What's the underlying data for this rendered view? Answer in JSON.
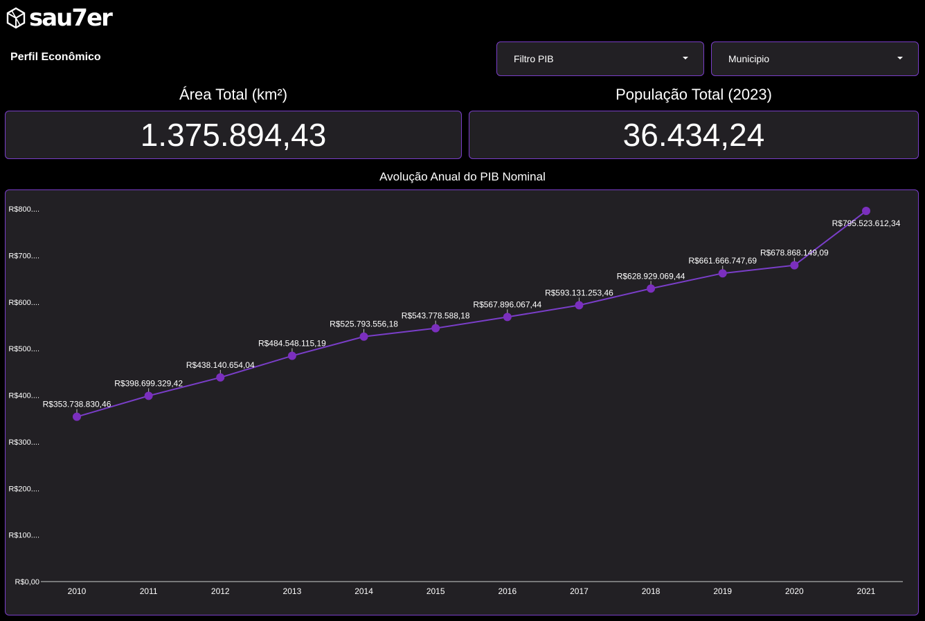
{
  "brand": {
    "name": "sau7er",
    "logo_icon": "geometric-hexagon-icon"
  },
  "page": {
    "title": "Perfil Econômico"
  },
  "filters": [
    {
      "label": "Filtro PIB"
    },
    {
      "label": "Municipio"
    }
  ],
  "kpis": {
    "area": {
      "title": "Área Total (km²)",
      "value": "1.375.894,43"
    },
    "population": {
      "title": "População Total (2023)",
      "value": "36.434,24"
    }
  },
  "colors": {
    "accent": "#7a3ec9",
    "point": "#7b2fbe",
    "panel": "#222024",
    "background": "#000000"
  },
  "chart_data": {
    "type": "line",
    "title": "Avolução Anual do PIB Nominal",
    "xlabel": "",
    "ylabel": "",
    "categories": [
      "2010",
      "2011",
      "2012",
      "2013",
      "2014",
      "2015",
      "2016",
      "2017",
      "2018",
      "2019",
      "2020",
      "2021"
    ],
    "series": [
      {
        "values": [
          353738830.46,
          398699329.42,
          438140654.04,
          484548115.19,
          525793556.18,
          543778588.18,
          567896067.44,
          593131253.46,
          628929069.44,
          661666747.69,
          678868149.09,
          795523612.34
        ],
        "labels": [
          "R$353.738.830,46",
          "R$398.699.329,42",
          "R$438.140.654,04",
          "R$484.548.115,19",
          "R$525.793.556,18",
          "R$543.778.588,18",
          "R$567.896.067,44",
          "R$593.131.253,46",
          "R$628.929.069,44",
          "R$661.666.747,69",
          "R$678.868.149,09",
          "R$795.523.612,34"
        ]
      }
    ],
    "y_ticks": [
      0,
      100000000,
      200000000,
      300000000,
      400000000,
      500000000,
      600000000,
      700000000,
      800000000
    ],
    "y_tick_labels": [
      "R$0,00",
      "R$100....",
      "R$200....",
      "R$300....",
      "R$400....",
      "R$500....",
      "R$600....",
      "R$700....",
      "R$800...."
    ],
    "ylim": [
      0,
      800000000
    ],
    "grid": false,
    "legend": "none"
  }
}
